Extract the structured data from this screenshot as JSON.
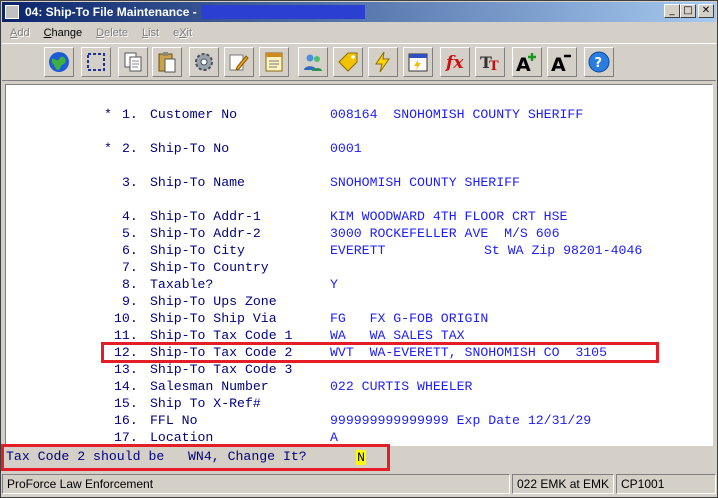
{
  "window": {
    "title": "04: Ship-To File Maintenance - ",
    "controls": {
      "minimize": "_",
      "maximize": "□",
      "close": "✕"
    }
  },
  "menu": [
    {
      "label": "Add",
      "accel": "A",
      "enabled": false
    },
    {
      "label": "Change",
      "accel": "C",
      "enabled": true
    },
    {
      "label": "Delete",
      "accel": "D",
      "enabled": false
    },
    {
      "label": "List",
      "accel": "L",
      "enabled": false
    },
    {
      "label": "eXit",
      "accel": "X",
      "enabled": false
    }
  ],
  "toolbar": [
    "globe-icon",
    "select-icon",
    "copy-icon",
    "paste-icon",
    "settings-icon",
    "edit-icon",
    "notepad-icon",
    "users-icon",
    "tag-icon",
    "lightning-icon",
    "calendar-icon",
    "function-icon",
    "font-icon",
    "font-larger-icon",
    "font-smaller-icon",
    "help-icon"
  ],
  "fields": [
    {
      "marker": "*",
      "num": "1.",
      "label": "Customer No",
      "value": "008164  SNOHOMISH COUNTY SHERIFF"
    },
    {
      "marker": "*",
      "num": "2.",
      "label": "Ship-To No",
      "value": "0001"
    },
    {
      "marker": "",
      "num": "3.",
      "label": "Ship-To Name",
      "value": "SNOHOMISH COUNTY SHERIFF"
    },
    {
      "marker": "",
      "num": "4.",
      "label": "Ship-To Addr-1",
      "value": "KIM WOODWARD 4TH FLOOR CRT HSE"
    },
    {
      "marker": "",
      "num": "5.",
      "label": "Ship-To Addr-2",
      "value": "3000 ROCKEFELLER AVE  M/S 606"
    },
    {
      "marker": "",
      "num": "6.",
      "label": "Ship-To City",
      "value": "EVERETT",
      "extra": "St WA Zip 98201-4046"
    },
    {
      "marker": "",
      "num": "7.",
      "label": "Ship-To Country",
      "value": ""
    },
    {
      "marker": "",
      "num": "8.",
      "label": "Taxable?",
      "value": "Y"
    },
    {
      "marker": "",
      "num": "9.",
      "label": "Ship-To Ups Zone",
      "value": ""
    },
    {
      "marker": "",
      "num": "10.",
      "label": "Ship-To Ship Via",
      "value": "FG   FX G-FOB ORIGIN"
    },
    {
      "marker": "",
      "num": "11.",
      "label": "Ship-To Tax Code 1",
      "value": "WA   WA SALES TAX"
    },
    {
      "marker": "",
      "num": "12.",
      "label": "Ship-To Tax Code 2",
      "value": "WVT  WA-EVERETT, SNOHOMISH CO  3105"
    },
    {
      "marker": "",
      "num": "13.",
      "label": "Ship-To Tax Code 3",
      "value": ""
    },
    {
      "marker": "",
      "num": "14.",
      "label": "Salesman Number",
      "value": "022 CURTIS WHEELER"
    },
    {
      "marker": "",
      "num": "15.",
      "label": "Ship To X-Ref#",
      "value": ""
    },
    {
      "marker": "",
      "num": "16.",
      "label": "FFL No",
      "value": "999999999999999 Exp Date 12/31/29"
    },
    {
      "marker": "",
      "num": "17.",
      "label": "Location",
      "value": "A"
    }
  ],
  "prompt": {
    "text": "Tax Code 2 should be   WN4, Change It?",
    "input_value": "N"
  },
  "statusbar": {
    "company": "ProForce Law Enforcement",
    "user": "022 EMK at EMK",
    "code": "CP1001"
  },
  "colors": {
    "highlight_box": "#e31e26",
    "field_text": "#000080",
    "value_text": "#1c1cff",
    "input_bg": "#ffff00"
  }
}
